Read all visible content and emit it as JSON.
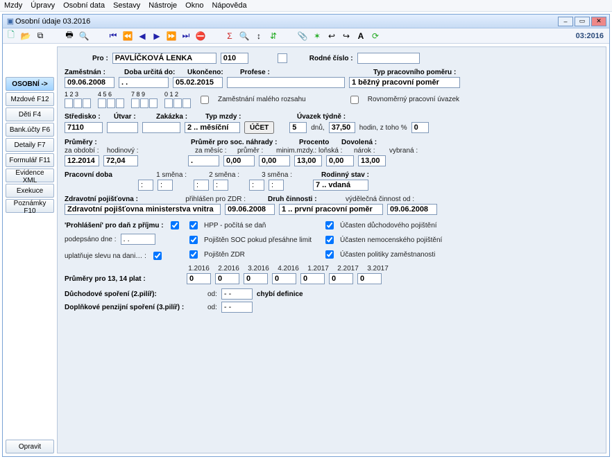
{
  "menu": {
    "items": [
      "Mzdy",
      "Úpravy",
      "Osobní data",
      "Sestavy",
      "Nástroje",
      "Okno",
      "Nápověda"
    ]
  },
  "window": {
    "title": "Osobní údaje 03.2016",
    "period": "03:2016"
  },
  "sidebar": {
    "items": [
      "OSOBNÍ ->",
      "Mzdové F12",
      "Děti F4",
      "Bank.účty F6",
      "Detaily F7",
      "Formulář F11",
      "Evidence XML",
      "Exekuce",
      "Poznámky F10"
    ],
    "opravit": "Opravit"
  },
  "hdr": {
    "pro_lbl": "Pro :",
    "pro_name": "PAVLÍČKOVÁ LENKA",
    "pro_num": "010",
    "rodne_lbl": "Rodné číslo :"
  },
  "emp": {
    "zamestnan": "Zaměstnán :",
    "doba_urcita": "Doba určitá do:",
    "ukonceno": "Ukončeno:",
    "profese": "Profese :",
    "typ_pomeru_lbl": "Typ pracovního poměru :",
    "date_from": "09.06.2008",
    "date_ddots": ".  .",
    "date_to": "05.02.2015",
    "typ_pomeru": "1 běžný pracovní poměr",
    "nums_hdr": [
      "1 2 3",
      "4 5 6",
      "7 8 9",
      "0 1 2"
    ],
    "zam_maly": "Zaměstnání malého rozsahu",
    "rovnomerny": "Rovnoměrný pracovní úvazek"
  },
  "loc": {
    "stredisko_lbl": "Středisko :",
    "utvar_lbl": "Útvar :",
    "zakazka_lbl": "Zakázka :",
    "typ_mzdy_lbl": "Typ mzdy :",
    "uvazek_lbl": "Úvazek týdně :",
    "stredisko": "7110",
    "typ_mzdy": "2 .. měsíční",
    "ucet_btn": "ÚČET",
    "uvazek_dnu": "5",
    "dnu_lbl": "dnů,",
    "uvazek_hod": "37,50",
    "hodin_lbl": "hodin, z toho %",
    "pct": "0"
  },
  "avg": {
    "prumery": "Průměry :",
    "za_obdobi": "za období :",
    "hodinovy": "hodinový :",
    "prumer_soc": "Průměr pro soc. náhrady :",
    "za_mesic": "za měsíc :",
    "prumer": "průměr :",
    "procento": "Procento",
    "minim_mzdy": "minim.mzdy.:",
    "dovolena": "Dovolená :",
    "lonska": "loňská :",
    "narok": "nárok :",
    "vybrana": "vybraná :",
    "ob_val": "12.2014",
    "hod_val": "72,04",
    "mes_val": ".",
    "prum_val": "0,00",
    "min_val": "0,00",
    "lon_val": "13,00",
    "nar_val": "0,00",
    "vyb_val": "13,00"
  },
  "work": {
    "prac_doba": "Pracovní doba",
    "smena1": "1 směna :",
    "smena2": "2 směna :",
    "smena3": "3 směna :",
    "colon": ":",
    "rodinny_stav": "Rodinný stav :",
    "rodinny_val": "7 .. vdaná"
  },
  "ins": {
    "zp_lbl": "Zdravotní pojišťovna :",
    "zp_prihlasen": "přihlášen pro ZDR :",
    "zp_val": "Zdravotní pojišťovna ministerstva vnitra",
    "zp_date": "09.06.2008",
    "druh_lbl": "Druh činnosti :",
    "druh_val": "1 .. první pracovní poměr",
    "vyd_lbl": "výdělečná činnost od :",
    "vyd_date": "09.06.2008"
  },
  "tax": {
    "prohl": "'Prohlášení' pro daň z příjmu :",
    "podepsano": "podepsáno dne :",
    "podepsano_val": ".  .",
    "uplatnuje": "uplatňuje slevu na dani… :",
    "hpp": "HPP - počítá se daň",
    "soc": "Pojištěn SOC pokud přesáhne limit",
    "zdr": "Pojištěn ZDR",
    "duch": "Účasten důchodového pojištění",
    "nem": "Účasten nemocenského pojištění",
    "zam": "Účasten politiky zaměstnanosti"
  },
  "plat13": {
    "lbl": "Průměry pro 13, 14 plat :",
    "cols": [
      "1.2016",
      "2.2016",
      "3.2016",
      "4.2016",
      "1.2017",
      "2.2017",
      "3.2017"
    ],
    "vals": [
      "0",
      "0",
      "0",
      "0",
      "0",
      "0",
      "0"
    ]
  },
  "pens": {
    "duch_spor": "Důchodové spoření (2.pilíř):",
    "dopln_spor": "Doplňkové penzijní spoření (3.pilíř) :",
    "od": "od:",
    "dash": "- -",
    "chybi": "chybí definice"
  }
}
